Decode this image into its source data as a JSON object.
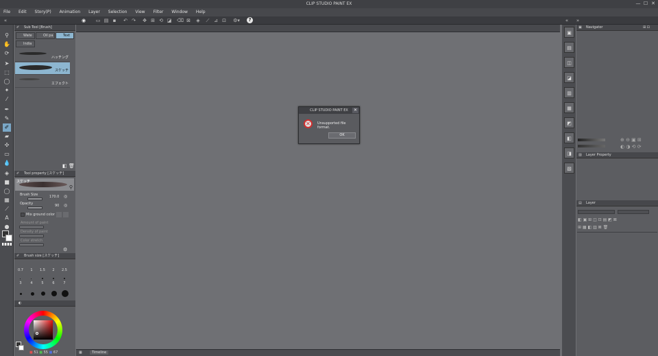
{
  "app": {
    "title": "CLIP STUDIO PAINT EX"
  },
  "window_controls": [
    "—",
    "☐",
    "✕"
  ],
  "menu": [
    "File",
    "Edit",
    "Story(P)",
    "Animation",
    "Layer",
    "Selection",
    "View",
    "Filter",
    "Window",
    "Help"
  ],
  "sub_tool": {
    "header": "Sub Tool [Brush]",
    "tabs": [
      "Wate",
      "Oil pa",
      "Text",
      "India"
    ],
    "brushes": [
      "ハッチング",
      "スケッチ",
      "エフェクト"
    ]
  },
  "tool_property": {
    "header": "Tool property [スケッチ]",
    "preview_label": "スケッチ",
    "brush_size_label": "Brush Size",
    "brush_size_value": "170.0",
    "opacity_label": "Opacity",
    "opacity_value": "90",
    "mix_ground_label": "Mix ground color",
    "amount_of_paint_label": "Amount of paint",
    "density_of_paint_label": "Density of paint",
    "color_stretch_label": "Color stretch"
  },
  "brush_size_panel": {
    "header": "Brush size [スケッチ]",
    "sizes": [
      "0.7",
      "1",
      "1.5",
      "2",
      "2.5",
      "3",
      "4",
      "5",
      "6",
      "7"
    ]
  },
  "color_values": {
    "r": "51",
    "g": "55",
    "b": "67"
  },
  "canvas": {
    "timeline_label": "Timeline"
  },
  "navigator": {
    "header": "Navigator"
  },
  "layer_property": {
    "header": "Layer Property"
  },
  "layer_panel": {
    "header": "Layer"
  },
  "dialog": {
    "title": "CLIP STUDIO PAINT EX",
    "message": "Unsupported file format.",
    "ok_label": "OK",
    "close_symbol": "✕",
    "icon_symbol": "✕"
  },
  "colors": {
    "accent": "#8db6d0",
    "error": "#d03030"
  }
}
